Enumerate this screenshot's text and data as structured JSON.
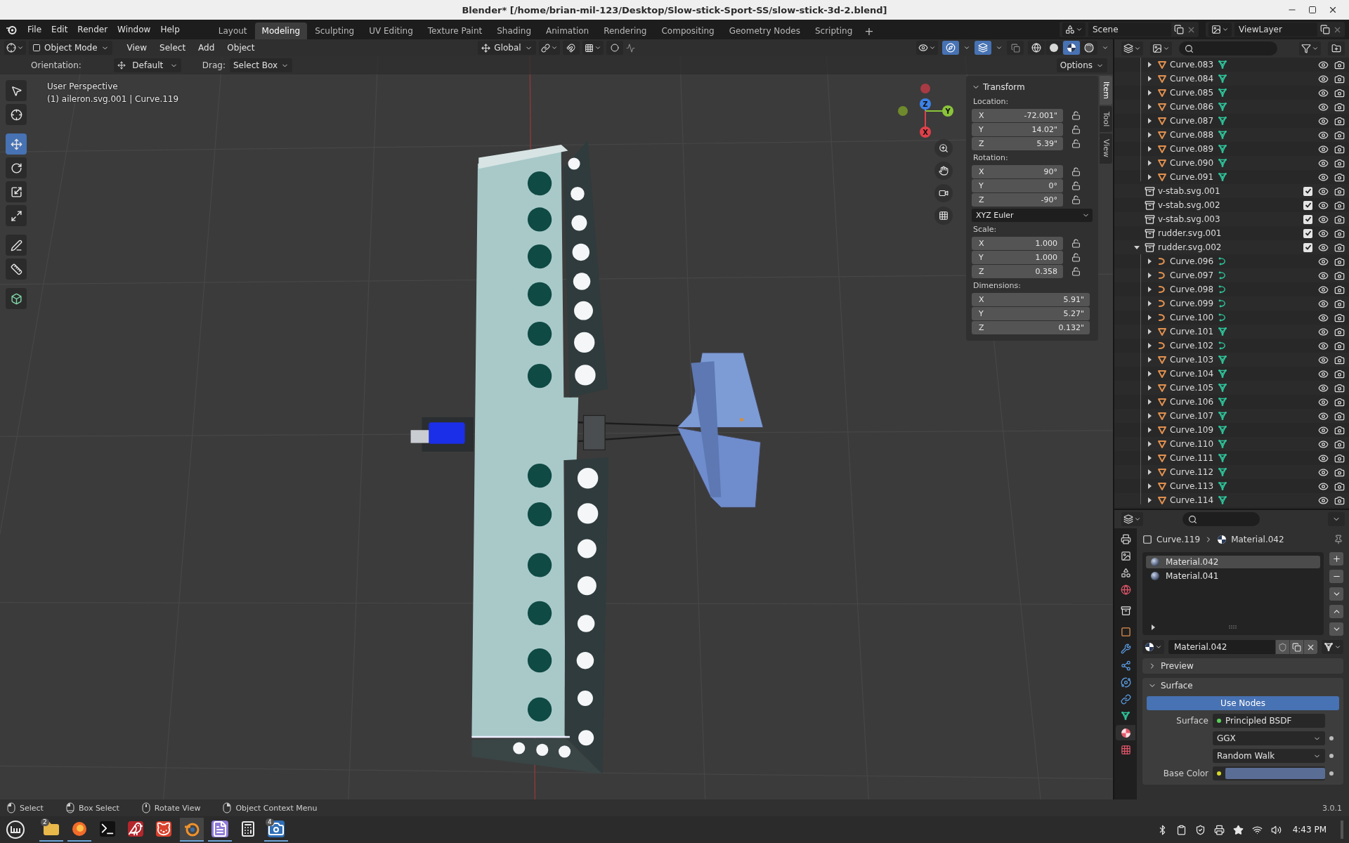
{
  "window": {
    "title": "Blender* [/home/brian-mil-123/Desktop/Slow-stick-Sport-SS/slow-stick-3d-2.blend]"
  },
  "menu": [
    "File",
    "Edit",
    "Render",
    "Window",
    "Help"
  ],
  "workspaces": [
    {
      "label": "Layout",
      "selected": false
    },
    {
      "label": "Modeling",
      "selected": true
    },
    {
      "label": "Sculpting",
      "selected": false
    },
    {
      "label": "UV Editing",
      "selected": false
    },
    {
      "label": "Texture Paint",
      "selected": false
    },
    {
      "label": "Shading",
      "selected": false
    },
    {
      "label": "Animation",
      "selected": false
    },
    {
      "label": "Rendering",
      "selected": false
    },
    {
      "label": "Compositing",
      "selected": false
    },
    {
      "label": "Geometry Nodes",
      "selected": false
    },
    {
      "label": "Scripting",
      "selected": false
    }
  ],
  "add_workspace": "+",
  "scene": "Scene",
  "view_layer": "ViewLayer",
  "viewport": {
    "mode": "Object Mode",
    "menus": [
      "View",
      "Select",
      "Add",
      "Object"
    ],
    "transform_orientation": "Global",
    "toggles": {
      "snap": false,
      "proportional": false,
      "gizmos": true,
      "overlays": true,
      "xray": false
    },
    "shading": [
      {
        "kind": "wireframe",
        "selected": false
      },
      {
        "kind": "solid",
        "selected": false
      },
      {
        "kind": "material",
        "selected": true
      },
      {
        "kind": "rendered",
        "selected": false
      }
    ],
    "orientation_label": "Orientation:",
    "orientation": "Default",
    "drag_label": "Drag:",
    "drag": "Select Box",
    "options": "Options",
    "tools": [
      {
        "kind": "select",
        "selected": false
      },
      {
        "kind": "cursor",
        "selected": false
      },
      {
        "kind": "move",
        "selected": true
      },
      {
        "kind": "rotate",
        "selected": false
      },
      {
        "kind": "scale",
        "selected": false
      },
      {
        "kind": "transform",
        "selected": false
      },
      {
        "kind": "annotate",
        "selected": false
      },
      {
        "kind": "measure",
        "selected": false
      },
      {
        "kind": "add_cube",
        "selected": false
      }
    ],
    "view_name": "User Perspective",
    "object_info": "(1) aileron.svg.001 | Curve.119",
    "gizmo": {
      "z": "Z",
      "y": "Y",
      "x": "X"
    },
    "sidebar_tabs": [
      {
        "label": "Item",
        "selected": true
      },
      {
        "label": "Tool",
        "selected": false
      },
      {
        "label": "View",
        "selected": false
      }
    ],
    "transform": {
      "title": "Transform",
      "expanded": true,
      "groups": [
        {
          "label": "Location:",
          "locks": true,
          "fields": [
            {
              "axis": "X",
              "value": "-72.001\""
            },
            {
              "axis": "Y",
              "value": "14.02\""
            },
            {
              "axis": "Z",
              "value": "5.39\""
            }
          ]
        },
        {
          "label": "Rotation:",
          "locks": true,
          "mode": "XYZ Euler",
          "fields": [
            {
              "axis": "X",
              "value": "90°"
            },
            {
              "axis": "Y",
              "value": "0°"
            },
            {
              "axis": "Z",
              "value": "-90°"
            }
          ]
        },
        {
          "label": "Scale:",
          "locks": true,
          "fields": [
            {
              "axis": "X",
              "value": "1.000"
            },
            {
              "axis": "Y",
              "value": "1.000"
            },
            {
              "axis": "Z",
              "value": "0.358"
            }
          ]
        },
        {
          "label": "Dimensions:",
          "locks": false,
          "fields": [
            {
              "axis": "X",
              "value": "5.91\""
            },
            {
              "axis": "Y",
              "value": "5.27\""
            },
            {
              "axis": "Z",
              "value": "0.132\""
            }
          ]
        }
      ]
    }
  },
  "outliner": {
    "scrolled_parent_children": [
      {
        "name": "Curve.083",
        "kind": "mesh",
        "expanded": false
      },
      {
        "name": "Curve.084",
        "kind": "mesh",
        "expanded": false
      },
      {
        "name": "Curve.085",
        "kind": "mesh",
        "expanded": false
      },
      {
        "name": "Curve.086",
        "kind": "mesh",
        "expanded": false
      },
      {
        "name": "Curve.087",
        "kind": "mesh",
        "expanded": false
      },
      {
        "name": "Curve.088",
        "kind": "mesh",
        "expanded": false
      },
      {
        "name": "Curve.089",
        "kind": "mesh",
        "expanded": false
      },
      {
        "name": "Curve.090",
        "kind": "mesh",
        "expanded": false
      },
      {
        "name": "Curve.091",
        "kind": "mesh",
        "expanded": false
      }
    ],
    "items": [
      {
        "name": "v-stab.svg.001",
        "kind": "collection",
        "checked": true,
        "expanded": false
      },
      {
        "name": "v-stab.svg.002",
        "kind": "collection",
        "checked": true,
        "expanded": false
      },
      {
        "name": "v-stab.svg.003",
        "kind": "collection",
        "checked": true,
        "expanded": false
      },
      {
        "name": "rudder.svg.001",
        "kind": "collection",
        "checked": true,
        "expanded": false
      },
      {
        "name": "rudder.svg.002",
        "kind": "collection",
        "checked": true,
        "expanded": true,
        "children": [
          {
            "name": "Curve.096",
            "kind": "curve",
            "expanded": false
          },
          {
            "name": "Curve.097",
            "kind": "curve",
            "expanded": false
          },
          {
            "name": "Curve.098",
            "kind": "curve",
            "expanded": false
          },
          {
            "name": "Curve.099",
            "kind": "curve",
            "expanded": false
          },
          {
            "name": "Curve.100",
            "kind": "curve",
            "expanded": false
          },
          {
            "name": "Curve.101",
            "kind": "mesh",
            "expanded": false
          },
          {
            "name": "Curve.102",
            "kind": "curve",
            "expanded": false
          },
          {
            "name": "Curve.103",
            "kind": "mesh",
            "expanded": false
          },
          {
            "name": "Curve.104",
            "kind": "mesh",
            "expanded": false
          },
          {
            "name": "Curve.105",
            "kind": "mesh",
            "expanded": false
          },
          {
            "name": "Curve.106",
            "kind": "mesh",
            "expanded": false
          },
          {
            "name": "Curve.107",
            "kind": "mesh",
            "expanded": false
          },
          {
            "name": "Curve.109",
            "kind": "mesh",
            "expanded": false
          },
          {
            "name": "Curve.110",
            "kind": "mesh",
            "expanded": false
          },
          {
            "name": "Curve.111",
            "kind": "mesh",
            "expanded": false
          },
          {
            "name": "Curve.112",
            "kind": "mesh",
            "expanded": false
          },
          {
            "name": "Curve.113",
            "kind": "mesh",
            "expanded": false
          },
          {
            "name": "Curve.114",
            "kind": "mesh",
            "expanded": false
          }
        ]
      }
    ]
  },
  "properties": {
    "tabs": [
      {
        "kind": "render",
        "selected": false
      },
      {
        "kind": "output",
        "selected": false
      },
      {
        "kind": "scene",
        "selected": false
      },
      {
        "kind": "world",
        "selected": false
      },
      {
        "kind": "collection",
        "selected": false
      },
      {
        "kind": "object",
        "selected": false
      },
      {
        "kind": "modifiers",
        "selected": false
      },
      {
        "kind": "particles",
        "selected": false
      },
      {
        "kind": "physics",
        "selected": false
      },
      {
        "kind": "constraints",
        "selected": false
      },
      {
        "kind": "data",
        "selected": false
      },
      {
        "kind": "material",
        "selected": true
      },
      {
        "kind": "texture",
        "selected": false
      }
    ],
    "breadcrumb": {
      "object": "Curve.119",
      "material": "Material.042"
    },
    "slots": [
      {
        "name": "Material.042",
        "selected": true
      },
      {
        "name": "Material.041",
        "selected": false
      }
    ],
    "material": "Material.042",
    "panels": [
      {
        "title": "Preview",
        "expanded": false
      },
      {
        "title": "Surface",
        "expanded": true,
        "use_nodes": "Use Nodes",
        "rows": [
          {
            "kind": "shader",
            "label": "Surface",
            "value": "Principled BSDF"
          },
          {
            "kind": "select",
            "value": "GGX"
          },
          {
            "kind": "select",
            "value": "Random Walk"
          },
          {
            "kind": "color",
            "label": "Base Color"
          }
        ]
      }
    ]
  },
  "status_bar": {
    "hints": [
      {
        "kind": "left",
        "label": "Select"
      },
      {
        "kind": "left_drag",
        "label": "Box Select"
      },
      {
        "kind": "middle",
        "label": "Rotate View"
      },
      {
        "kind": "right",
        "label": "Object Context Menu"
      }
    ],
    "version": "3.0.1"
  },
  "taskbar": {
    "apps": [
      {
        "kind": "files",
        "badge": "2",
        "running": true,
        "active": false
      },
      {
        "kind": "browser",
        "running": true,
        "active": false
      },
      {
        "kind": "terminal",
        "running": false,
        "active": false
      },
      {
        "kind": "bird",
        "running": false,
        "active": false
      },
      {
        "kind": "cat",
        "running": false,
        "active": false
      },
      {
        "kind": "ring",
        "running": true,
        "active": true
      },
      {
        "kind": "text",
        "running": true,
        "active": false
      },
      {
        "kind": "calculator",
        "running": false,
        "active": false
      },
      {
        "kind": "camera",
        "badge": "4",
        "running": true,
        "active": false
      }
    ],
    "clock": "4:43 PM"
  }
}
